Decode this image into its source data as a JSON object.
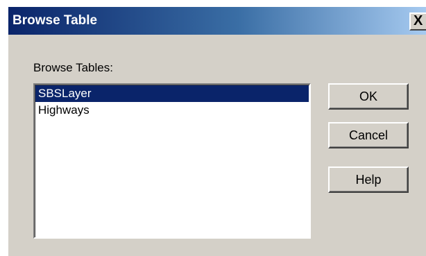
{
  "window": {
    "title": "Browse Table",
    "close_glyph": "X"
  },
  "form": {
    "label": "Browse Tables:",
    "items": [
      {
        "label": "SBSLayer",
        "selected": true
      },
      {
        "label": "Highways",
        "selected": false
      }
    ]
  },
  "buttons": {
    "ok": "OK",
    "cancel": "Cancel",
    "help": "Help"
  },
  "colors": {
    "title_gradient_start": "#0a246a",
    "title_gradient_end": "#a6caf0",
    "dialog_face": "#d4d0c8",
    "selection": "#0a246a"
  }
}
